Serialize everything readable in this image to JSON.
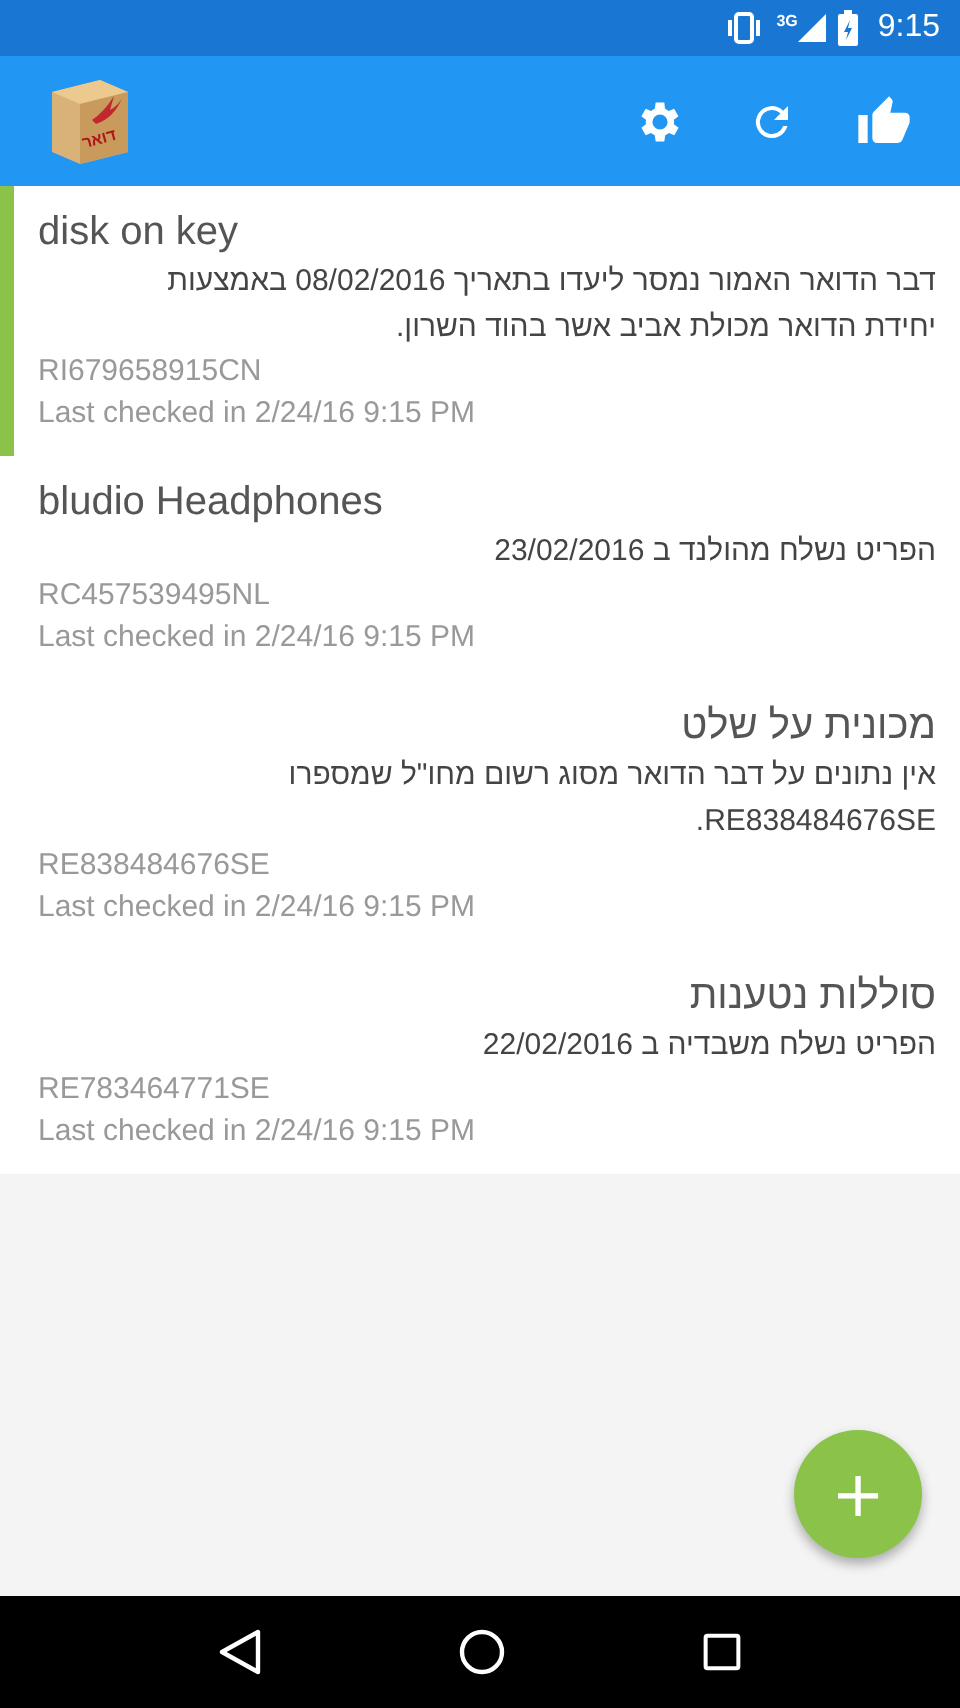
{
  "status_bar": {
    "network": "3G",
    "time": "9:15"
  },
  "app_bar": {
    "logo_text": "דואר"
  },
  "packages": [
    {
      "title": "disk on key",
      "status": "דבר הדואר האמור נמסר ליעדו בתאריך 08/02/2016 באמצעות יחידת הדואר מכולת אביב אשר בהוד השרון.",
      "tracking": "RI679658915CN",
      "checked": "Last checked in 2/24/16 9:15 PM",
      "selected": true
    },
    {
      "title": "bludio Headphones",
      "status": "הפריט נשלח מהולנד ב 23/02/2016",
      "tracking": "RC457539495NL",
      "checked": "Last checked in 2/24/16 9:15 PM",
      "selected": false
    },
    {
      "title": "מכונית על שלט",
      "status": "אין נתונים על דבר הדואר מסוג רשום מחו\"ל שמספרו RE838484676SE.",
      "tracking": "RE838484676SE",
      "checked": "Last checked in 2/24/16 9:15 PM",
      "selected": false
    },
    {
      "title": "סוללות נטענות",
      "status": "הפריט נשלח משבדיה ב 22/02/2016",
      "tracking": "RE783464771SE",
      "checked": "Last checked in 2/24/16 9:15 PM",
      "selected": false
    }
  ],
  "fab": {
    "label": "+"
  }
}
